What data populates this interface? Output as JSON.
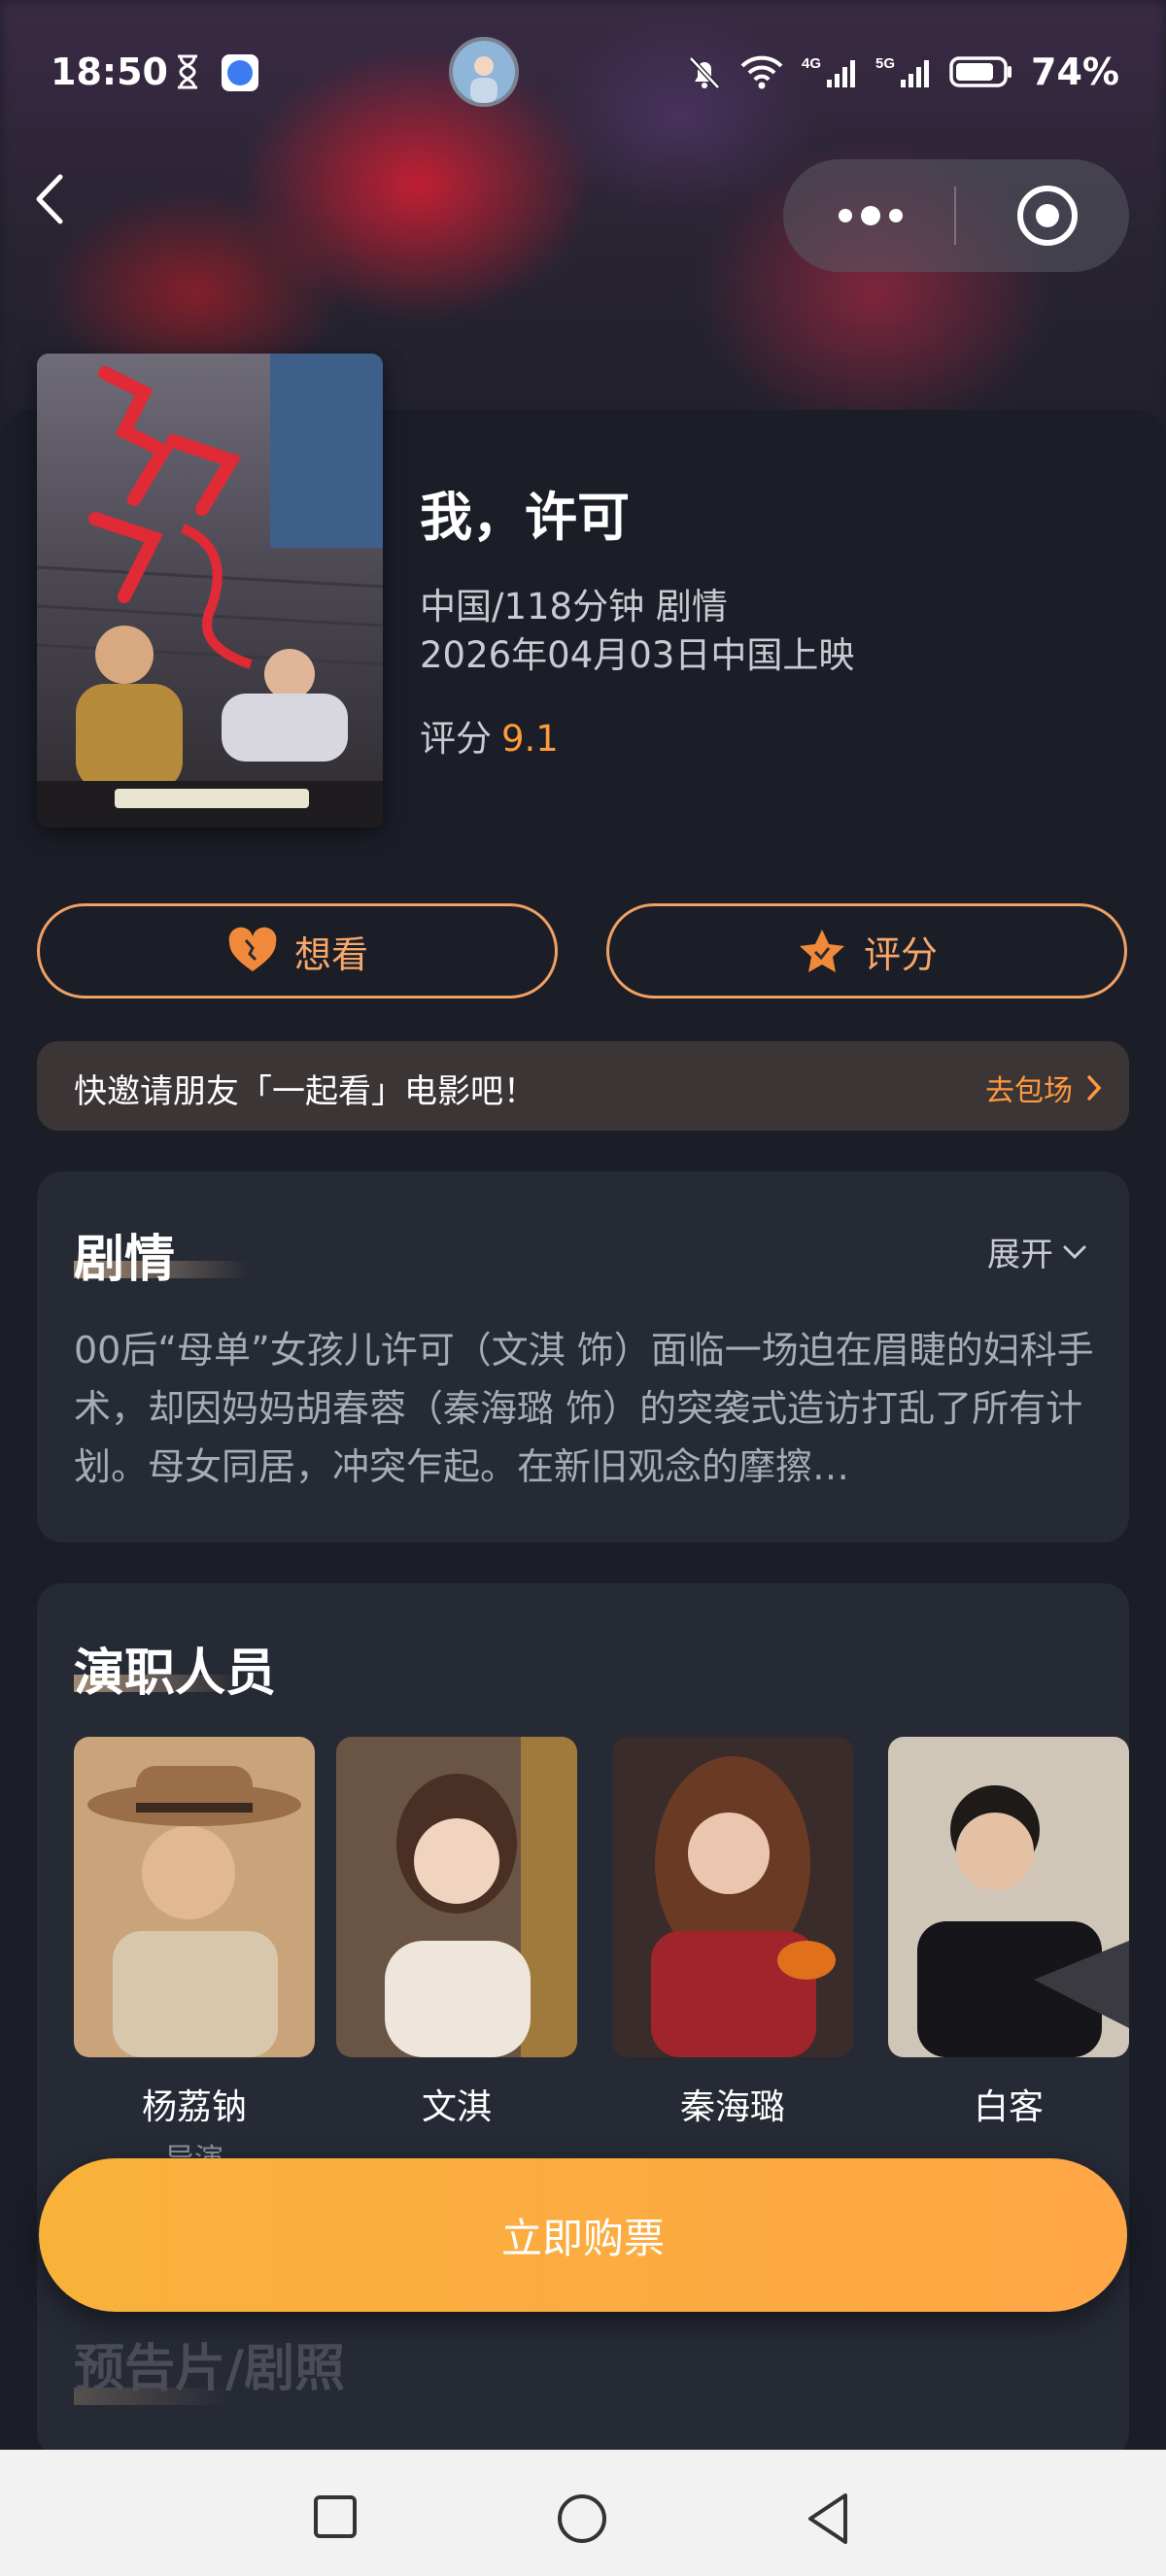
{
  "status_bar": {
    "time": "18:50",
    "network_4g": "4G",
    "network_5g": "5G",
    "battery": "74%"
  },
  "movie": {
    "title": "我，许可",
    "meta_line1": "中国/118分钟 剧情",
    "meta_line2": "2026年04月03日中国上映",
    "rating_label": "评分",
    "rating_value": "9.1"
  },
  "actions": {
    "want_label": "想看",
    "rate_label": "评分"
  },
  "invite": {
    "text": "快邀请朋友「一起看」电影吧！",
    "link": "去包场"
  },
  "plot": {
    "title": "剧情",
    "expand_label": "展开",
    "text": "00后“母单”女孩儿许可（文淇 饰）面临一场迫在眉睫的妇科手术，却因妈妈胡春蓉（秦海璐 饰）的突袭式造访打乱了所有计划。母女同居，冲突乍起。在新旧观念的摩擦…"
  },
  "cast": {
    "title": "演职人员",
    "members": [
      {
        "name": "杨荔钠",
        "role": "导演"
      },
      {
        "name": "文淇",
        "role": ""
      },
      {
        "name": "秦海璐",
        "role": ""
      },
      {
        "name": "白客",
        "role": ""
      }
    ]
  },
  "buy_button": "立即购票",
  "trailer_title": "预告片/剧照",
  "colors": {
    "accent": "#ff9a3c",
    "buy_button": "#f8b23a",
    "background": "#1b1e27",
    "card": "#262a35"
  }
}
